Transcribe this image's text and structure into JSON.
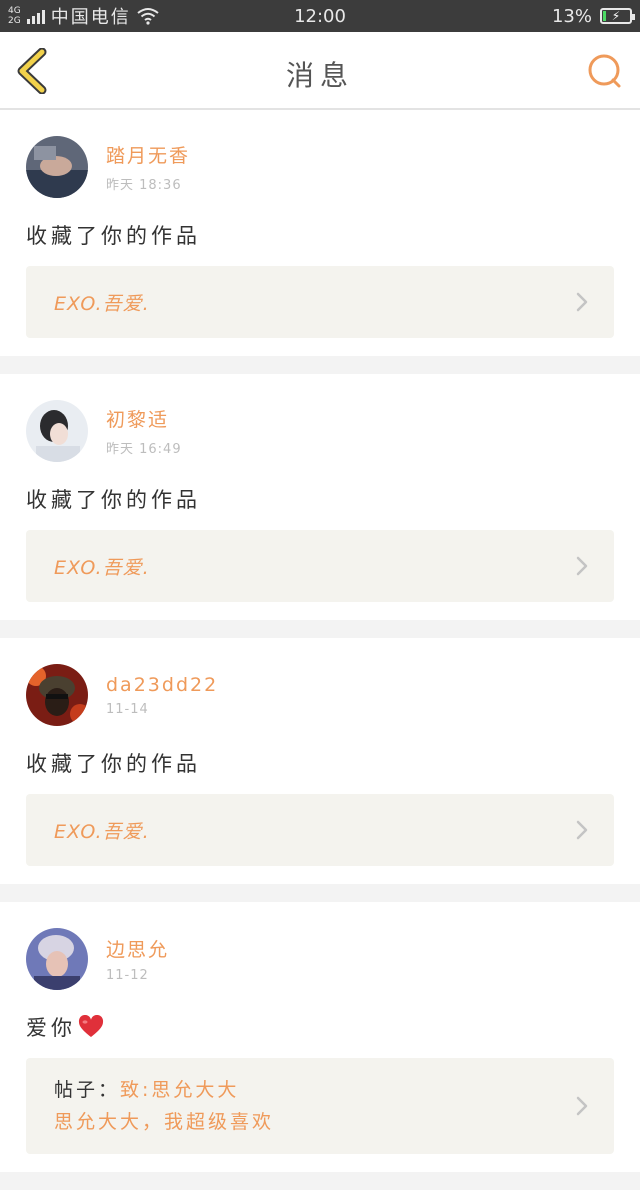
{
  "status_bar": {
    "net_top": "4G",
    "net_bottom": "2G",
    "carrier": "中国电信",
    "time": "12:00",
    "battery": "13%",
    "battery_level": 0.13
  },
  "nav": {
    "title": "消息",
    "back_icon": "chevron-left-icon",
    "search_icon": "search-icon"
  },
  "colors": {
    "accent": "#ef9a5a",
    "back_icon": "#f2d24b",
    "status_bg": "#3c3c3c",
    "ref_bg": "#f4f3ee"
  },
  "messages": [
    {
      "user": "踏月无香",
      "time": "昨天 18:36",
      "text": "收藏了你的作品",
      "ref": "EXO.吾爱."
    },
    {
      "user": "初黎适",
      "time": "昨天 16:49",
      "text": "收藏了你的作品",
      "ref": "EXO.吾爱."
    },
    {
      "user": "da23dd22",
      "time": "11-14",
      "text": "收藏了你的作品",
      "ref": "EXO.吾爱."
    },
    {
      "user": "边思允",
      "time": "11-12",
      "text": "爱你",
      "ref_label": "帖子：",
      "ref_title": "致:思允大大",
      "ref_body": "思允大大，我超级喜欢"
    }
  ]
}
